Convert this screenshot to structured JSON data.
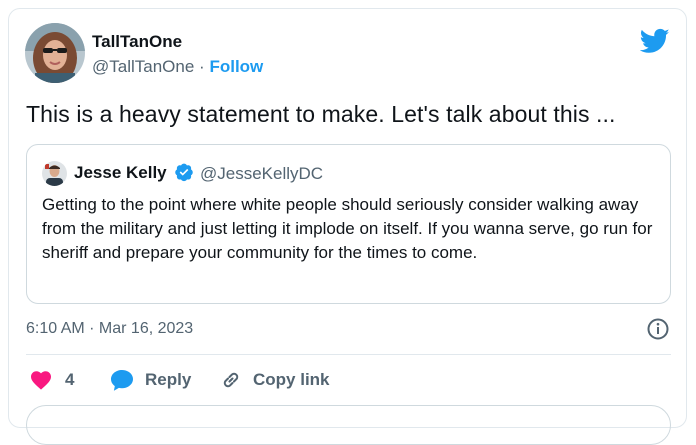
{
  "author": {
    "name": "TallTanOne",
    "handle": "@TallTanOne",
    "separator": "·",
    "follow_label": "Follow"
  },
  "tweet": {
    "text": "This is a heavy statement to make. Let's talk about this ...",
    "timestamp": "6:10 AM · Mar 16, 2023"
  },
  "quote": {
    "name": "Jesse Kelly",
    "handle": "@JesseKellyDC",
    "verified": true,
    "text": "Getting to the point where white people should seriously consider walking away from the military and just letting it implode on itself. If you wanna serve, go run for sheriff and prepare your community for the times to come."
  },
  "actions": {
    "like_count": "4",
    "reply_label": "Reply",
    "copy_label": "Copy link"
  },
  "icons": {
    "brand": "twitter-bird-icon",
    "verified": "verified-badge-icon",
    "info": "info-icon",
    "like": "heart-icon",
    "reply": "reply-bubble-icon",
    "copy": "link-icon"
  },
  "colors": {
    "brand_blue": "#1d9bf0",
    "like_pink": "#f91880",
    "text_secondary": "#536471",
    "border": "#cfd9de"
  }
}
